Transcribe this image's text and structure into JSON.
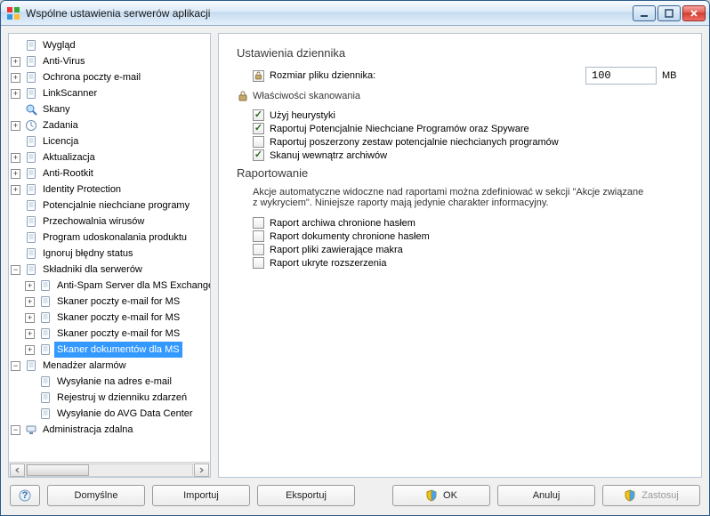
{
  "window": {
    "title": "Wspólne ustawienia serwerów aplikacji"
  },
  "tree": [
    {
      "label": "Wygląd",
      "expand": "",
      "icon": "page"
    },
    {
      "label": "Anti-Virus",
      "expand": "+",
      "icon": "page"
    },
    {
      "label": "Ochrona poczty e-mail",
      "expand": "+",
      "icon": "page"
    },
    {
      "label": "LinkScanner",
      "expand": "+",
      "icon": "page"
    },
    {
      "label": "Skany",
      "expand": "",
      "icon": "search"
    },
    {
      "label": "Zadania",
      "expand": "+",
      "icon": "clock"
    },
    {
      "label": "Licencja",
      "expand": "",
      "icon": "page"
    },
    {
      "label": "Aktualizacja",
      "expand": "+",
      "icon": "page"
    },
    {
      "label": "Anti-Rootkit",
      "expand": "+",
      "icon": "page"
    },
    {
      "label": "Identity Protection",
      "expand": "+",
      "icon": "page"
    },
    {
      "label": "Potencjalnie niechciane programy",
      "expand": "",
      "icon": "page"
    },
    {
      "label": "Przechowalnia wirusów",
      "expand": "",
      "icon": "page"
    },
    {
      "label": "Program udoskonalania produktu",
      "expand": "",
      "icon": "page"
    },
    {
      "label": "Ignoruj błędny status",
      "expand": "",
      "icon": "page"
    },
    {
      "label": "Składniki dla serwerów",
      "expand": "-",
      "icon": "page",
      "children": [
        {
          "label": "Anti-Spam Server dla MS Exchange",
          "expand": "+",
          "icon": "page"
        },
        {
          "label": "Skaner poczty e-mail for MS",
          "expand": "+",
          "icon": "page"
        },
        {
          "label": "Skaner poczty e-mail for MS",
          "expand": "+",
          "icon": "page"
        },
        {
          "label": "Skaner poczty e-mail for MS",
          "expand": "+",
          "icon": "page"
        },
        {
          "label": "Skaner dokumentów dla MS",
          "expand": "+",
          "icon": "page",
          "selected": true
        }
      ]
    },
    {
      "label": "Menadżer alarmów",
      "expand": "-",
      "icon": "page",
      "children": [
        {
          "label": "Wysyłanie na adres e-mail",
          "expand": "",
          "icon": "page"
        },
        {
          "label": "Rejestruj w dzienniku zdarzeń",
          "expand": "",
          "icon": "page"
        },
        {
          "label": "Wysyłanie do AVG Data Center",
          "expand": "",
          "icon": "page"
        }
      ]
    },
    {
      "label": "Administracja zdalna",
      "expand": "-",
      "icon": "admin"
    }
  ],
  "log": {
    "heading": "Ustawienia dziennika",
    "size_label": "Rozmiar pliku dziennika:",
    "size_value": "100",
    "size_unit": "MB"
  },
  "scan": {
    "heading": "Właściwości skanowania",
    "items": [
      {
        "label": "Użyj heurystyki",
        "checked": true
      },
      {
        "label": "Raportuj Potencjalnie Niechciane Programów oraz Spyware",
        "checked": true
      },
      {
        "label": "Raportuj poszerzony zestaw potencjalnie niechcianych programów",
        "checked": false
      },
      {
        "label": "Skanuj wewnątrz archiwów",
        "checked": true
      }
    ]
  },
  "report": {
    "heading": "Raportowanie",
    "desc": "Akcje automatyczne widoczne nad raportami można zdefiniować w sekcji \"Akcje związane z wykryciem\". Niniejsze raporty mają jedynie charakter informacyjny.",
    "items": [
      {
        "label": "Raport archiwa chronione hasłem",
        "checked": false
      },
      {
        "label": "Raport dokumenty chronione hasłem",
        "checked": false
      },
      {
        "label": "Raport pliki zawierające makra",
        "checked": false
      },
      {
        "label": "Raport ukryte rozszerzenia",
        "checked": false
      }
    ]
  },
  "buttons": {
    "defaults": "Domyślne",
    "import": "Importuj",
    "export": "Eksportuj",
    "ok": "OK",
    "cancel": "Anuluj",
    "apply": "Zastosuj"
  }
}
